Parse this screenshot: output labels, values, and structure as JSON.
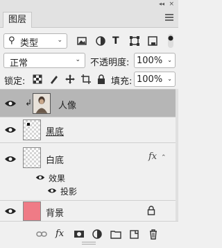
{
  "window": {
    "collapse_glyph": "◂◂",
    "close_glyph": "×"
  },
  "tab": {
    "label": "图层"
  },
  "filter": {
    "label": "类型",
    "icons": [
      "image-filter-icon",
      "adjustment-filter-icon",
      "type-filter-icon",
      "shape-filter-icon",
      "smart-object-filter-icon"
    ],
    "type_glyph": "T"
  },
  "blend": {
    "mode": "正常",
    "opacity_label": "不透明度:",
    "opacity_value": "100%"
  },
  "lock": {
    "label": "锁定:",
    "fill_label": "填充:",
    "fill_value": "100%"
  },
  "layers": [
    {
      "name": "人像",
      "selected": true,
      "clipped": true
    },
    {
      "name": "黑底",
      "selected": false
    },
    {
      "name": "白底",
      "selected": false,
      "fx_glyph": "fx",
      "effects_label": "效果",
      "effect_name": "投影"
    },
    {
      "name": "背景",
      "selected": false,
      "locked": true
    }
  ],
  "bottom": {
    "fx_glyph": "fx"
  },
  "colors": {
    "panel_bg": "#f0f0f0",
    "selected_row": "#b6b6b6",
    "background_thumb": "#ef7b86"
  }
}
